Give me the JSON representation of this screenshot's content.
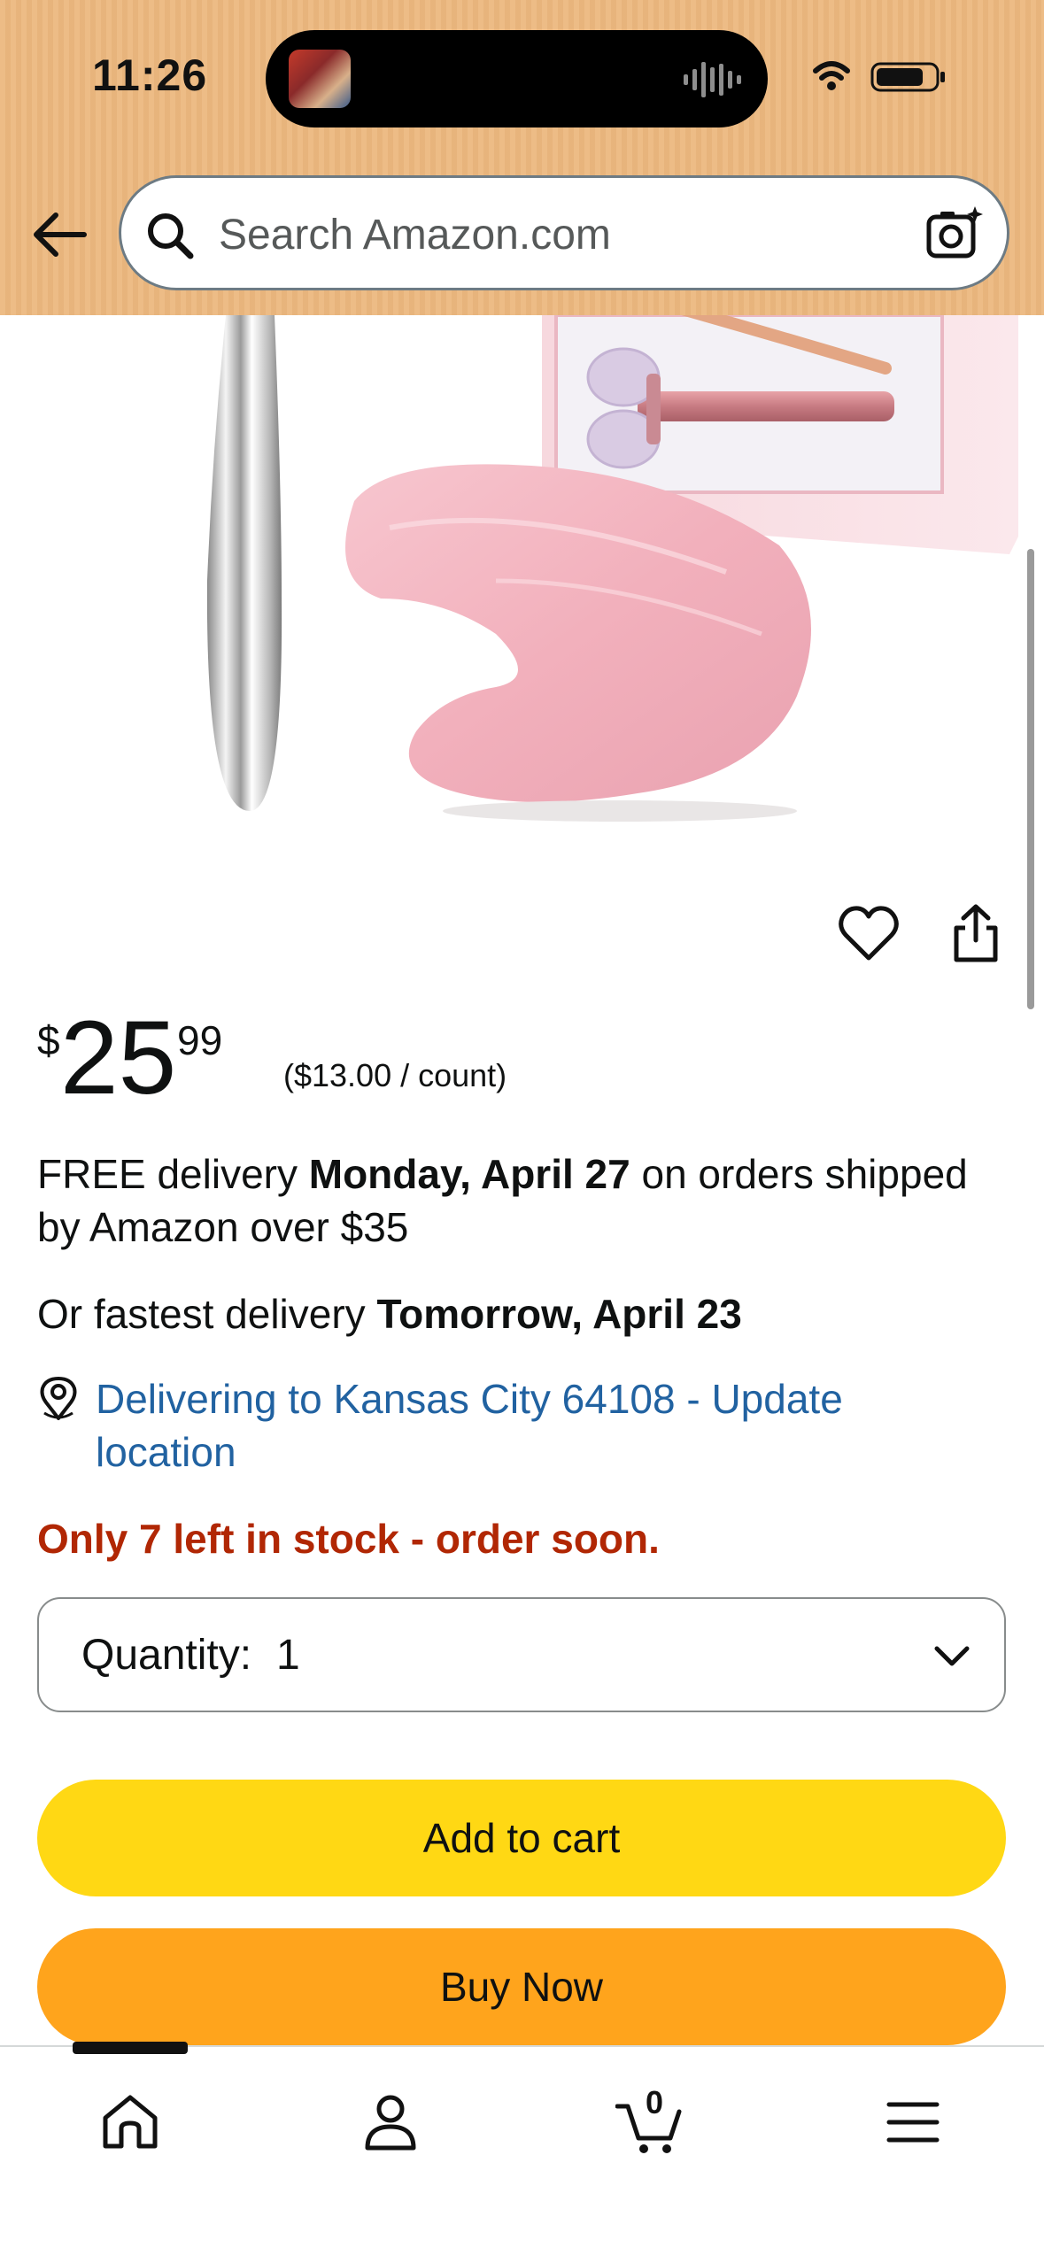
{
  "status_bar": {
    "time": "11:26"
  },
  "header": {
    "search_placeholder": "Search Amazon.com"
  },
  "product": {
    "price_symbol": "$",
    "price_whole": "25",
    "price_fraction": "99",
    "unit_price": "($13.00 / count)"
  },
  "delivery": {
    "prefix": "FREE delivery ",
    "date": "Monday, April 27",
    "suffix": " on orders shipped by Amazon over $35",
    "fastest_prefix": "Or fastest delivery ",
    "fastest_date": "Tomorrow, April 23",
    "location_link": "Delivering to Kansas City 64108 - Update location"
  },
  "stock": {
    "message": "Only 7 left in stock - order soon."
  },
  "quantity": {
    "label": "Quantity:",
    "value": "1"
  },
  "actions": {
    "add_to_cart": "Add to cart",
    "buy_now": "Buy Now"
  },
  "bottom_nav": {
    "items": [
      {
        "name": "home",
        "icon": "home-icon"
      },
      {
        "name": "account",
        "icon": "person-icon"
      },
      {
        "name": "cart",
        "icon": "cart-icon",
        "count": "0"
      },
      {
        "name": "menu",
        "icon": "menu-icon"
      }
    ]
  },
  "colors": {
    "header_bg": "#ecb87e",
    "add_to_cart": "#ffd814",
    "buy_now": "#ffa41c",
    "stock_red": "#b12704",
    "link_blue": "#2162a1"
  }
}
